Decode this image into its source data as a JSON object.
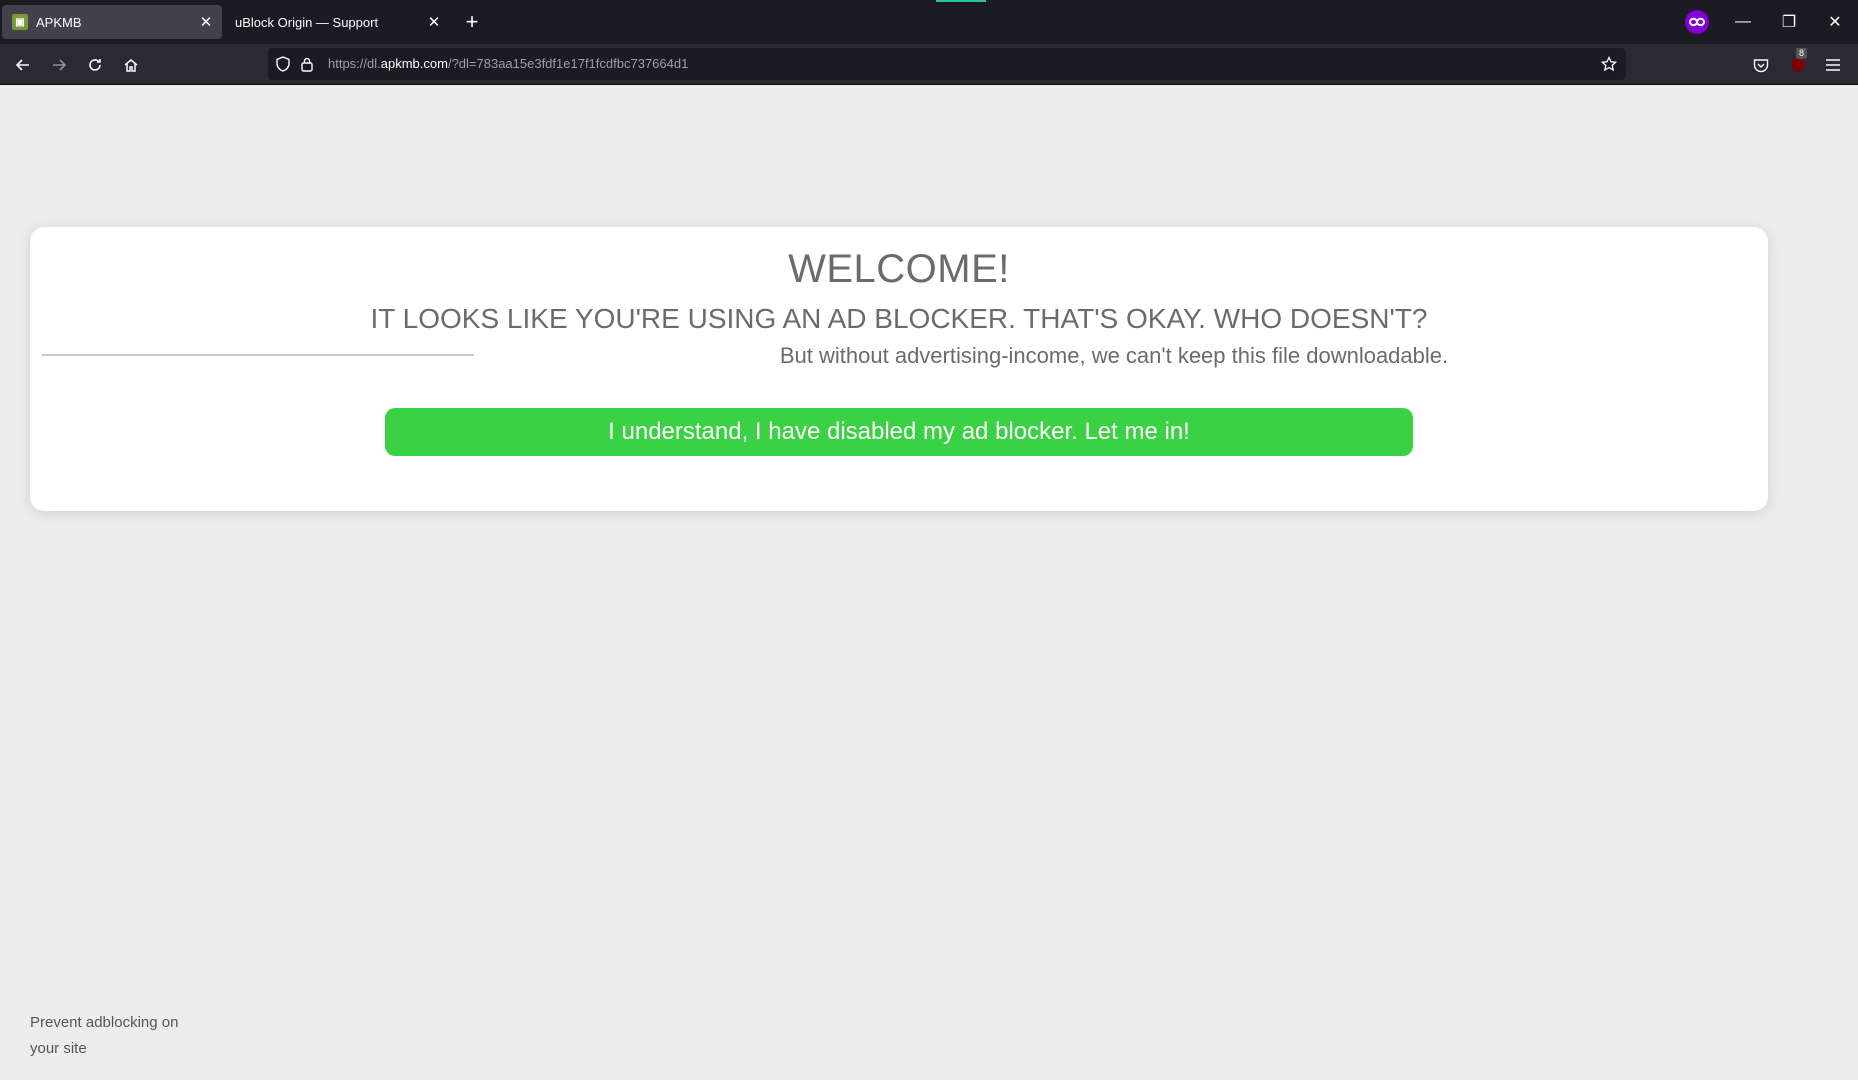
{
  "browser": {
    "tabs": [
      {
        "title": "APKMB",
        "active": true
      },
      {
        "title": "uBlock Origin — Support",
        "active": false
      }
    ],
    "new_tab_label": "+",
    "url": {
      "scheme": "https://dl.",
      "host": "apkmb.com",
      "rest": "/?dl=783aa15e3fdf1e17f1fcdfbc737664d1"
    },
    "ublock_count": "8",
    "window_controls": {
      "minimize": "—",
      "restore": "❐",
      "close": "✕"
    }
  },
  "page": {
    "heading": "WELCOME!",
    "subheading": "IT LOOKS LIKE YOU'RE USING AN AD BLOCKER. THAT'S OKAY. WHO DOESN'T?",
    "message": "But without advertising-income, we can't keep this file downloadable.",
    "button_label": "I understand, I have disabled my ad blocker. Let me in!",
    "footer_link": "Prevent adblocking on your site"
  },
  "colors": {
    "button": "#3bd144",
    "page_background": "#ececec",
    "text": "#6b6b6b",
    "private_browsing": "#8000d7"
  }
}
